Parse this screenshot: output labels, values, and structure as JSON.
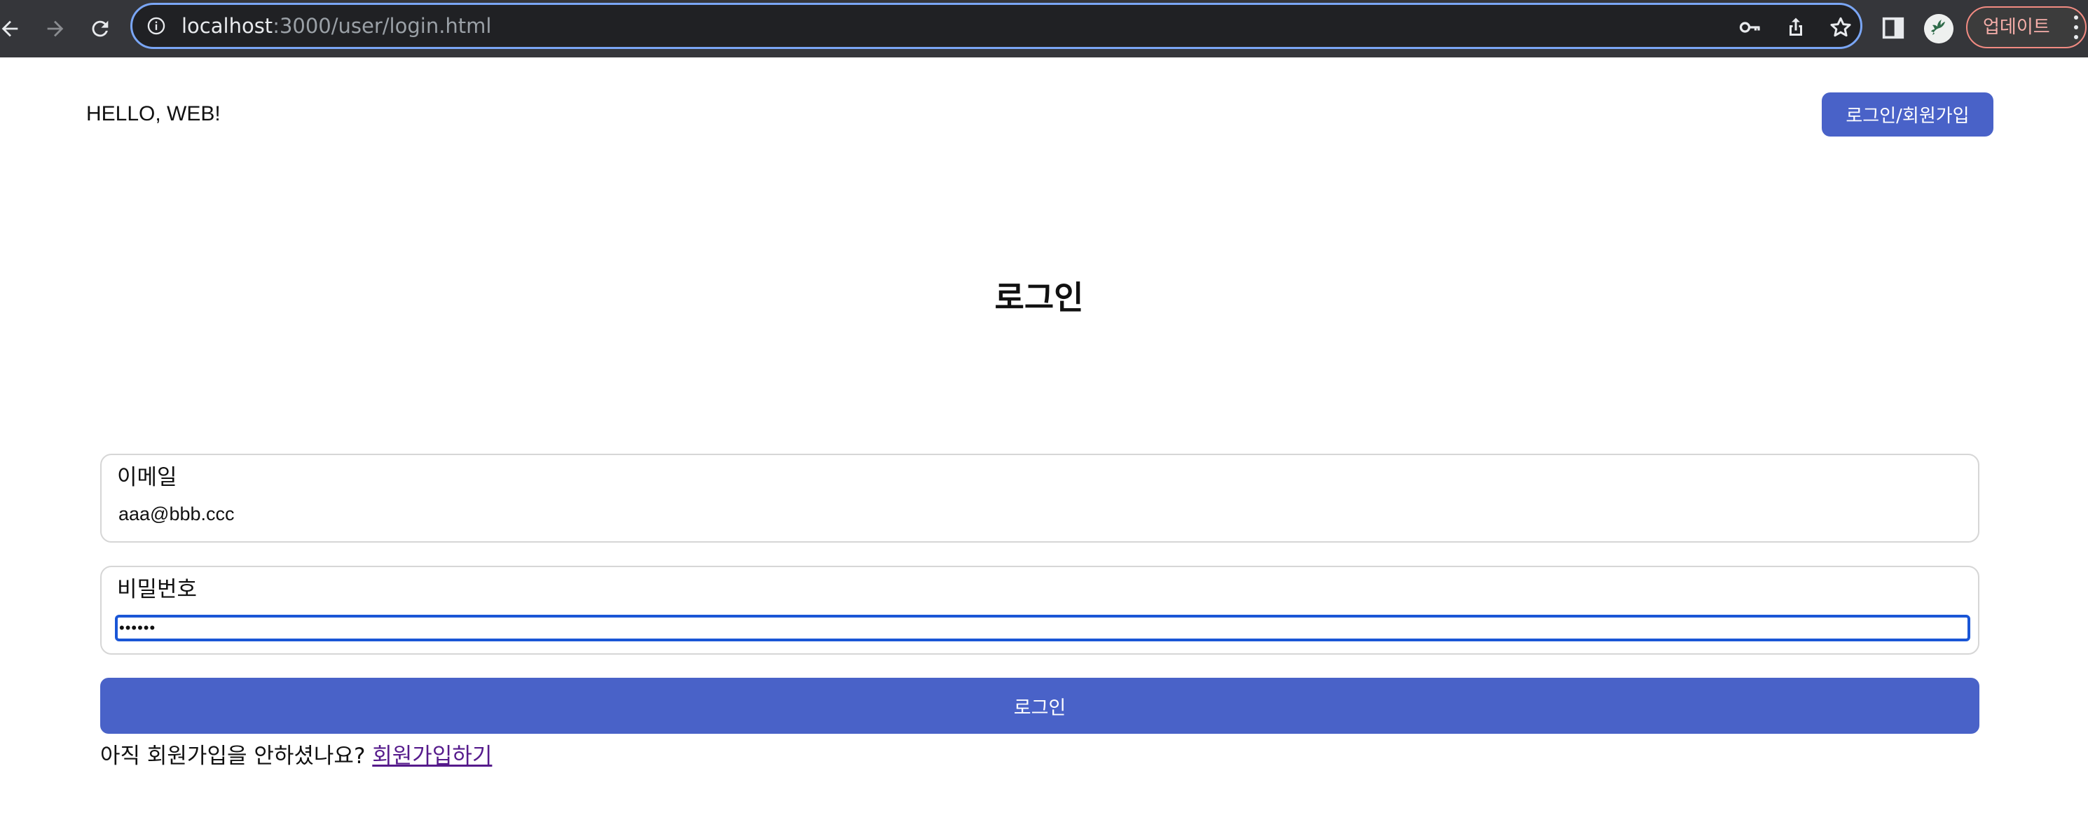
{
  "browser": {
    "url_host": "localhost",
    "url_path": ":3000/user/login.html",
    "update_label": "업데이트",
    "icons": {
      "back": "back-arrow-icon",
      "forward": "forward-arrow-icon",
      "reload": "reload-icon",
      "site_info": "info-icon",
      "password": "key-icon",
      "share": "share-icon",
      "bookmark": "star-icon",
      "side_panel": "side-panel-icon",
      "profile": "avatar",
      "menu": "kebab-menu-icon"
    },
    "colors": {
      "chrome_bg": "#35363a",
      "omnibox_bg": "#202124",
      "omnibox_focus": "#7aa6f5",
      "update_accent": "#f28b82"
    }
  },
  "header": {
    "brand": "HELLO, WEB!",
    "auth_button": "로그인/회원가입"
  },
  "login": {
    "title": "로그인",
    "email": {
      "label": "이메일",
      "value": "aaa@bbb.ccc"
    },
    "password": {
      "label": "비밀번호",
      "value": "••••••"
    },
    "submit": "로그인",
    "signup_prompt": "아직 회원가입을 안하셨나요?",
    "signup_link": "회원가입하기"
  },
  "colors": {
    "primary": "#4962c8",
    "link_visited": "#551a8b",
    "focus_ring": "#1a56d6"
  }
}
